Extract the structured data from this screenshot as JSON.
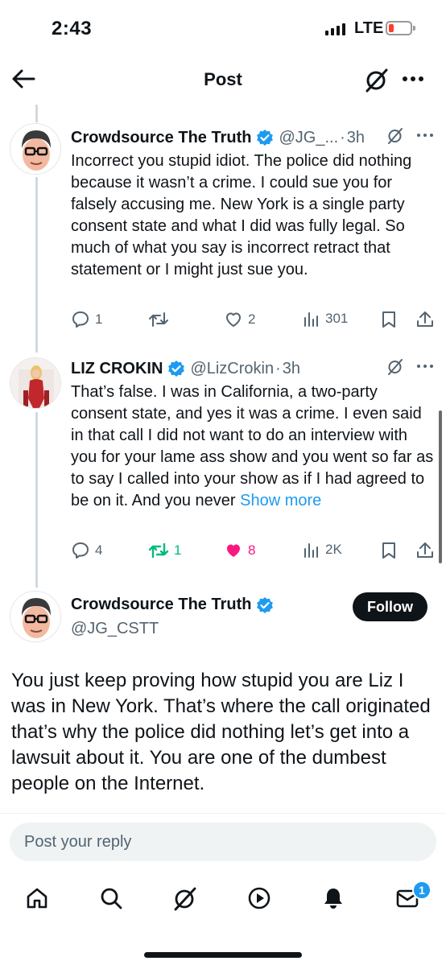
{
  "status_bar": {
    "time": "2:43",
    "network": "LTE"
  },
  "header": {
    "title": "Post"
  },
  "replies": [
    {
      "name": "Crowdsource The Truth",
      "handle": "@JG_...",
      "sep": "·",
      "age": "3h",
      "text": "Incorrect you stupid idiot. The police did nothing because it wasn’t a crime. I could sue you for falsely accusing me. New York is a single party consent state and what I did was fully legal. So much of what you say is incorrect retract that statement or I might just sue you.",
      "stats": {
        "replies": "1",
        "reposts": "",
        "likes": "2",
        "views": "301"
      }
    },
    {
      "name": "LIZ CROKIN",
      "handle": "@LizCrokin",
      "sep": "·",
      "age": "3h",
      "text": "That’s false. I was in California, a two-party consent state, and yes it was a crime. I even said in that call I did not want to do an interview with you for your lame ass show and you went so far as to say I called into your show as if I had agreed to be on it. And you never ",
      "show_more": "Show more",
      "stats": {
        "replies": "4",
        "reposts": "1",
        "likes": "8",
        "views": "2K"
      },
      "colors": {
        "repost_active": "#00ba7c",
        "like_active": "#f91880"
      }
    }
  ],
  "main_post": {
    "name": "Crowdsource The Truth",
    "handle": "@JG_CSTT",
    "follow_label": "Follow",
    "text": "You just keep proving how stupid you are Liz I was in New York. That’s where the call originated that’s why the police did nothing let’s get into a lawsuit about it. You are one of the dumbest people on the Internet."
  },
  "reply_box": {
    "placeholder": "Post your reply"
  },
  "tab_bar": {
    "icons": [
      "home-icon",
      "search-icon",
      "grok-icon",
      "video-icon",
      "notifications-icon",
      "messages-icon"
    ],
    "messages_badge": "1"
  },
  "colors": {
    "accent": "#1d9bf0",
    "text": "#0f1419",
    "secondary": "#536471"
  }
}
